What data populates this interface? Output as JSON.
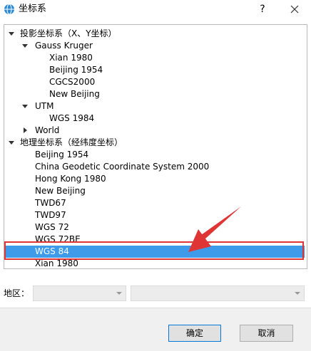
{
  "window": {
    "title": "坐标系",
    "help_label": "?"
  },
  "tree": {
    "items": [
      {
        "label": "投影坐标系（X、Y坐标）",
        "expanded": true
      },
      {
        "label": "Gauss Kruger",
        "expanded": true
      },
      {
        "label": "Xian 1980"
      },
      {
        "label": "Beijing 1954"
      },
      {
        "label": "CGCS2000"
      },
      {
        "label": "New Beijing"
      },
      {
        "label": "UTM",
        "expanded": true
      },
      {
        "label": "WGS 1984"
      },
      {
        "label": "World",
        "expanded": false
      },
      {
        "label": "地理坐标系（经纬度坐标）",
        "expanded": true
      },
      {
        "label": "Beijing 1954"
      },
      {
        "label": "China Geodetic Coordinate System 2000"
      },
      {
        "label": "Hong Kong 1980"
      },
      {
        "label": "New Beijing"
      },
      {
        "label": "TWD67"
      },
      {
        "label": "TWD97"
      },
      {
        "label": "WGS 72"
      },
      {
        "label": "WGS 72BE"
      },
      {
        "label": "WGS 84",
        "selected": true
      },
      {
        "label": "Xian 1980"
      }
    ]
  },
  "region": {
    "label": "地区：",
    "combo1_value": "",
    "combo2_value": ""
  },
  "buttons": {
    "ok": "确定",
    "cancel": "取消"
  },
  "colors": {
    "selection": "#3d9be9",
    "annotation": "#e03535"
  }
}
